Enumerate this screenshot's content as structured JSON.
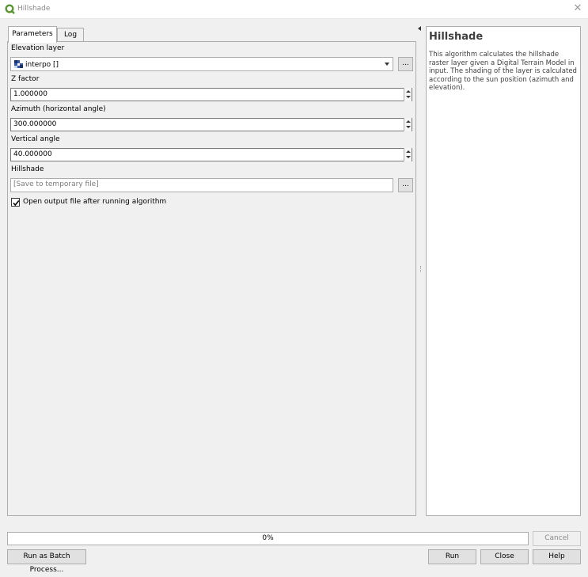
{
  "window": {
    "title": "Hillshade",
    "icon": "qgis-logo-icon"
  },
  "tabs": [
    {
      "label": "Parameters",
      "active": true
    },
    {
      "label": "Log",
      "active": false
    }
  ],
  "params": {
    "elevation_label": "Elevation layer",
    "elevation_value": "interpo []",
    "elevation_icon": "raster-layer-icon",
    "zfactor_label": "Z factor",
    "zfactor_value": "1.000000",
    "azimuth_label": "Azimuth (horizontal angle)",
    "azimuth_value": "300.000000",
    "vertical_label": "Vertical angle",
    "vertical_value": "40.000000",
    "output_label": "Hillshade",
    "output_placeholder": "[Save to temporary file]",
    "open_output_label": "Open output file after running algorithm",
    "open_output_checked": true,
    "browse_label": "..."
  },
  "help": {
    "title": "Hillshade",
    "text": "This algorithm calculates the hillshade raster layer given a Digital Terrain Model in input. The shading of the layer is calculated according to the sun position (azimuth and elevation)."
  },
  "progress": {
    "text": "0%",
    "value": 0
  },
  "buttons": {
    "cancel": "Cancel",
    "batch": "Run as Batch Process...",
    "run": "Run",
    "close": "Close",
    "help": "Help"
  },
  "colors": {
    "accent_green": "#589632",
    "border": "#adadad",
    "background": "#f0f0f0"
  }
}
